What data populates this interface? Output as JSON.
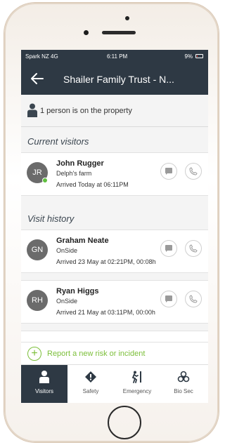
{
  "status_bar": {
    "carrier": "Spark NZ  4G",
    "time": "6:11 PM",
    "battery_text": "9%"
  },
  "header": {
    "title": "Shailer Family Trust - N..."
  },
  "presence": {
    "text": "1 person is on the property"
  },
  "current_visitors": {
    "heading": "Current visitors",
    "items": [
      {
        "initials": "JR",
        "name": "John Rugger",
        "org": "Delph's farm",
        "arrived": "Arrived Today at 06:11PM",
        "online": true
      }
    ]
  },
  "visit_history": {
    "heading": "Visit history",
    "items": [
      {
        "initials": "GN",
        "name": "Graham Neate",
        "org": "OnSide",
        "arrived": "Arrived 23 May at 02:21PM, 00:08h"
      },
      {
        "initials": "RH",
        "name": "Ryan Higgs",
        "org": "OnSide",
        "arrived": "Arrived 21 May at 03:11PM, 00:00h"
      }
    ]
  },
  "report": {
    "label": "Report a new risk or incident"
  },
  "tabs": [
    {
      "label": "Visitors",
      "icon": "person-icon",
      "active": true
    },
    {
      "label": "Safety",
      "icon": "diamond-warning-icon",
      "active": false
    },
    {
      "label": "Emergency",
      "icon": "running-exit-icon",
      "active": false
    },
    {
      "label": "Bio Sec",
      "icon": "biohazard-icon",
      "active": false
    }
  ],
  "colors": {
    "header_bg": "#2e3944",
    "accent_green": "#7cbf3a",
    "online_green": "#5fbf3d",
    "avatar_gray": "#6b6b6b"
  }
}
